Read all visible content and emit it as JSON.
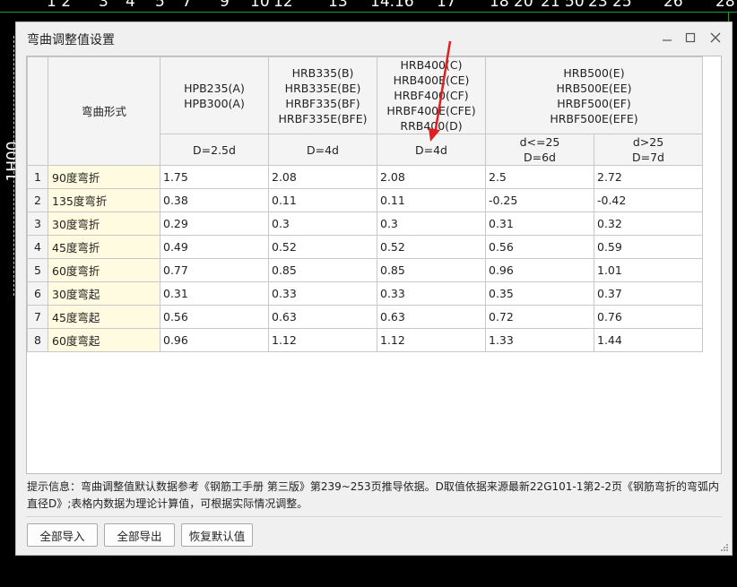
{
  "cad": {
    "ticks": [
      "1 2",
      "3",
      "4",
      "5",
      "7",
      "9",
      "10",
      "12",
      "13",
      "14.16",
      "17",
      "18",
      "20",
      "21 50",
      "23",
      "25",
      "26",
      "28"
    ],
    "side_label": "1H00"
  },
  "dialog": {
    "title": "弯曲调整值设置",
    "controls": {
      "minimize": "—",
      "maximize": "□",
      "close": "✕"
    }
  },
  "table": {
    "shape_header": "弯曲形式",
    "groups": [
      {
        "label": "HPB235(A)\nHPB300(A)"
      },
      {
        "label": "HRB335(B)\nHRB335E(BE)\nHRBF335(BF)\nHRBF335E(BFE)"
      },
      {
        "label": "HRB400(C)\nHRB400E(CE)\nHRBF400(CF)\nHRBF400E(CFE)\nRRB400(D)"
      },
      {
        "label": "HRB500(E)\nHRB500E(EE)\nHRBF500(EF)\nHRBF500E(EFE)"
      }
    ],
    "subheaders": [
      "D=2.5d",
      "D=4d",
      "D=4d",
      "d<=25\nD=6d",
      "d>25\nD=7d"
    ],
    "rows": [
      {
        "num": "1",
        "shape": "90度弯折",
        "values": [
          "1.75",
          "2.08",
          "2.08",
          "2.5",
          "2.72"
        ]
      },
      {
        "num": "2",
        "shape": "135度弯折",
        "values": [
          "0.38",
          "0.11",
          "0.11",
          "-0.25",
          "-0.42"
        ]
      },
      {
        "num": "3",
        "shape": "30度弯折",
        "values": [
          "0.29",
          "0.3",
          "0.3",
          "0.31",
          "0.32"
        ]
      },
      {
        "num": "4",
        "shape": "45度弯折",
        "values": [
          "0.49",
          "0.52",
          "0.52",
          "0.56",
          "0.59"
        ]
      },
      {
        "num": "5",
        "shape": "60度弯折",
        "values": [
          "0.77",
          "0.85",
          "0.85",
          "0.96",
          "1.01"
        ]
      },
      {
        "num": "6",
        "shape": "30度弯起",
        "values": [
          "0.31",
          "0.33",
          "0.33",
          "0.35",
          "0.37"
        ]
      },
      {
        "num": "7",
        "shape": "45度弯起",
        "values": [
          "0.56",
          "0.63",
          "0.63",
          "0.72",
          "0.76"
        ]
      },
      {
        "num": "8",
        "shape": "60度弯起",
        "values": [
          "0.96",
          "1.12",
          "1.12",
          "1.33",
          "1.44"
        ]
      }
    ]
  },
  "hint": {
    "line1": "提示信息：弯曲调整值默认数据参考《钢筋工手册  第三版》第239~253页推导依据。D取值依据来源最新22G101-1第2-2页《钢筋弯折的弯弧内",
    "line2": "直径D》;表格内数据为理论计算值，可根据实际情况调整。"
  },
  "buttons": {
    "import_all": "全部导入",
    "export_all": "全部导出",
    "restore_default": "恢复默认值"
  },
  "colors": {
    "annotation_arrow": "#e02020",
    "shape_cell_bg": "#fffbe0"
  }
}
